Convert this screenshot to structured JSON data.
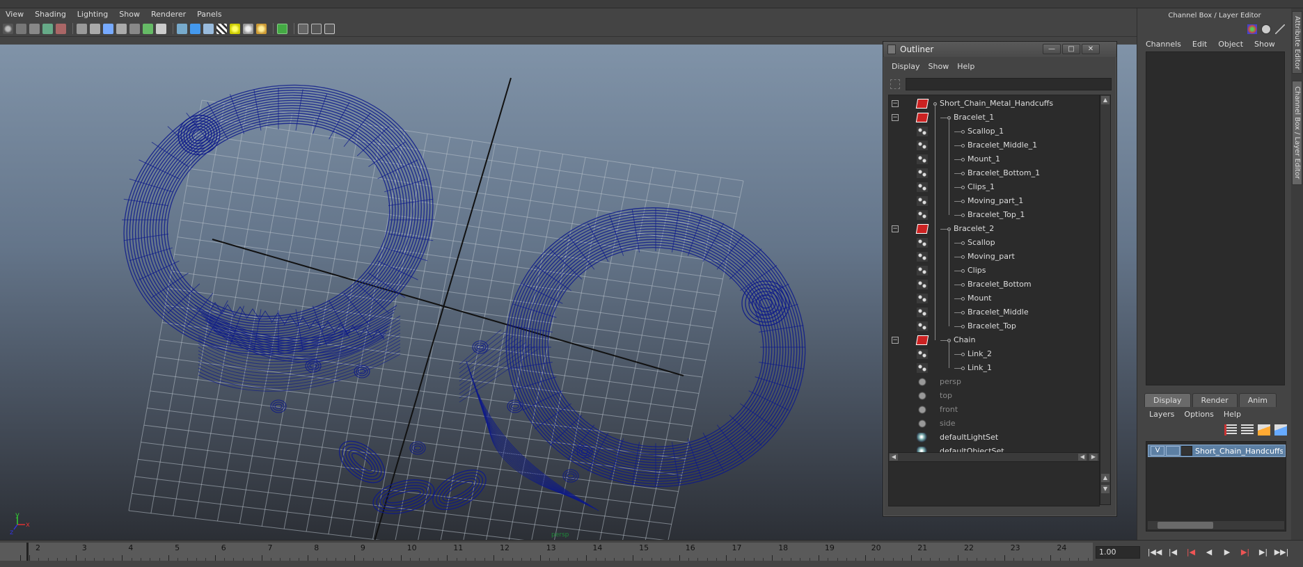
{
  "viewport": {
    "menu": [
      "View",
      "Shading",
      "Lighting",
      "Show",
      "Renderer",
      "Panels"
    ],
    "camera_label": "persp",
    "axis": {
      "x": "x",
      "y": "y",
      "z": "z"
    },
    "wire_color": "#0d1a8a"
  },
  "channel_box": {
    "title": "Channel Box / Layer Editor",
    "menu": [
      "Channels",
      "Edit",
      "Object",
      "Show"
    ]
  },
  "layer_editor": {
    "tabs": [
      "Display",
      "Render",
      "Anim"
    ],
    "active_tab": "Display",
    "menu": [
      "Layers",
      "Options",
      "Help"
    ],
    "layer": {
      "visible": "V",
      "name": "Short_Chain_Handcuffs_l"
    }
  },
  "side_tabs": {
    "attribute_editor": "Attribute Editor",
    "channel_box": "Channel Box / Layer Editor"
  },
  "outliner": {
    "title": "Outliner",
    "menu": [
      "Display",
      "Show",
      "Help"
    ],
    "window_buttons": {
      "minimize": "—",
      "maximize": "□",
      "close": "✕"
    },
    "items": [
      {
        "label": "Short_Chain_Metal_Handcuffs",
        "depth": 0,
        "icon": "transform-icon",
        "expand": "−"
      },
      {
        "label": "Bracelet_1",
        "depth": 1,
        "icon": "transform-icon",
        "expand": "−"
      },
      {
        "label": "Scallop_1",
        "depth": 2,
        "icon": "mesh-icon"
      },
      {
        "label": "Bracelet_Middle_1",
        "depth": 2,
        "icon": "mesh-icon"
      },
      {
        "label": "Mount_1",
        "depth": 2,
        "icon": "mesh-icon"
      },
      {
        "label": "Bracelet_Bottom_1",
        "depth": 2,
        "icon": "mesh-icon"
      },
      {
        "label": "Clips_1",
        "depth": 2,
        "icon": "mesh-icon"
      },
      {
        "label": "Moving_part_1",
        "depth": 2,
        "icon": "mesh-icon"
      },
      {
        "label": "Bracelet_Top_1",
        "depth": 2,
        "icon": "mesh-icon"
      },
      {
        "label": "Bracelet_2",
        "depth": 1,
        "icon": "transform-icon",
        "expand": "−"
      },
      {
        "label": "Scallop",
        "depth": 2,
        "icon": "mesh-icon"
      },
      {
        "label": "Moving_part",
        "depth": 2,
        "icon": "mesh-icon"
      },
      {
        "label": "Clips",
        "depth": 2,
        "icon": "mesh-icon"
      },
      {
        "label": "Bracelet_Bottom",
        "depth": 2,
        "icon": "mesh-icon"
      },
      {
        "label": "Mount",
        "depth": 2,
        "icon": "mesh-icon"
      },
      {
        "label": "Bracelet_Middle",
        "depth": 2,
        "icon": "mesh-icon"
      },
      {
        "label": "Bracelet_Top",
        "depth": 2,
        "icon": "mesh-icon"
      },
      {
        "label": "Chain",
        "depth": 1,
        "icon": "transform-icon",
        "expand": "−"
      },
      {
        "label": "Link_2",
        "depth": 2,
        "icon": "mesh-icon"
      },
      {
        "label": "Link_1",
        "depth": 2,
        "icon": "mesh-icon"
      },
      {
        "label": "persp",
        "depth": 0,
        "icon": "camera-icon",
        "dim": true
      },
      {
        "label": "top",
        "depth": 0,
        "icon": "camera-icon",
        "dim": true
      },
      {
        "label": "front",
        "depth": 0,
        "icon": "camera-icon",
        "dim": true
      },
      {
        "label": "side",
        "depth": 0,
        "icon": "camera-icon",
        "dim": true
      },
      {
        "label": "defaultLightSet",
        "depth": 0,
        "icon": "set-icon"
      },
      {
        "label": "defaultObjectSet",
        "depth": 0,
        "icon": "set-icon"
      }
    ]
  },
  "timeline": {
    "frames": [
      "2",
      "3",
      "4",
      "5",
      "6",
      "7",
      "8",
      "9",
      "10",
      "11",
      "12",
      "13",
      "14",
      "15",
      "16",
      "17",
      "18",
      "19",
      "20",
      "21",
      "22",
      "23",
      "24"
    ],
    "current_time": "1.00",
    "buttons": [
      "|◀◀",
      "|◀",
      "|◀",
      "◀",
      "▶",
      "▶|",
      "▶|",
      "▶▶|"
    ]
  }
}
